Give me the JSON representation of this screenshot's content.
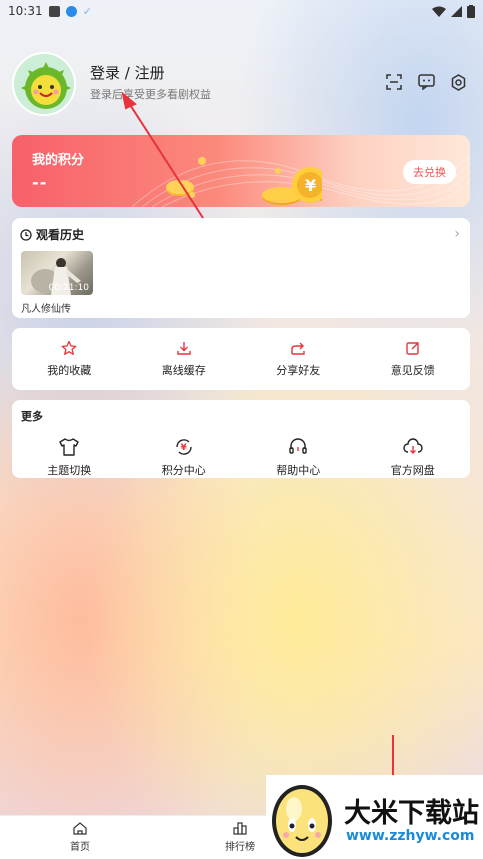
{
  "status_bar": {
    "time": "10:31",
    "check_glyph": "✓"
  },
  "profile": {
    "login_label": "登录 / 注册",
    "subtitle": "登录后享受更多看剧权益",
    "icons": [
      "scan-icon",
      "message-icon",
      "settings-icon"
    ]
  },
  "points": {
    "title": "我的积分",
    "value": "--",
    "redeem_label": "去兑换",
    "colors": {
      "start": "#f8606a",
      "end": "#ffe8d8"
    }
  },
  "history": {
    "title": "观看历史",
    "items": [
      {
        "title": "凡人修仙传",
        "timestamp": "00:21:10"
      }
    ]
  },
  "actions": [
    {
      "label": "我的收藏",
      "icon": "star-icon"
    },
    {
      "label": "离线缓存",
      "icon": "download-icon"
    },
    {
      "label": "分享好友",
      "icon": "share-icon"
    },
    {
      "label": "意见反馈",
      "icon": "feedback-icon"
    }
  ],
  "more": {
    "title": "更多",
    "items": [
      {
        "label": "主题切换",
        "icon": "tshirt-icon"
      },
      {
        "label": "积分中心",
        "icon": "yen-refresh-icon"
      },
      {
        "label": "帮助中心",
        "icon": "headset-icon"
      },
      {
        "label": "官方网盘",
        "icon": "cloud-download-icon"
      }
    ]
  },
  "bottom_nav": [
    {
      "label": "首页",
      "icon": "home-icon"
    },
    {
      "label": "排行榜",
      "icon": "ranking-icon"
    }
  ],
  "watermark": {
    "title": "大米下载站",
    "url": "www.zzhyw.com"
  },
  "accent_color": "#e8323c"
}
